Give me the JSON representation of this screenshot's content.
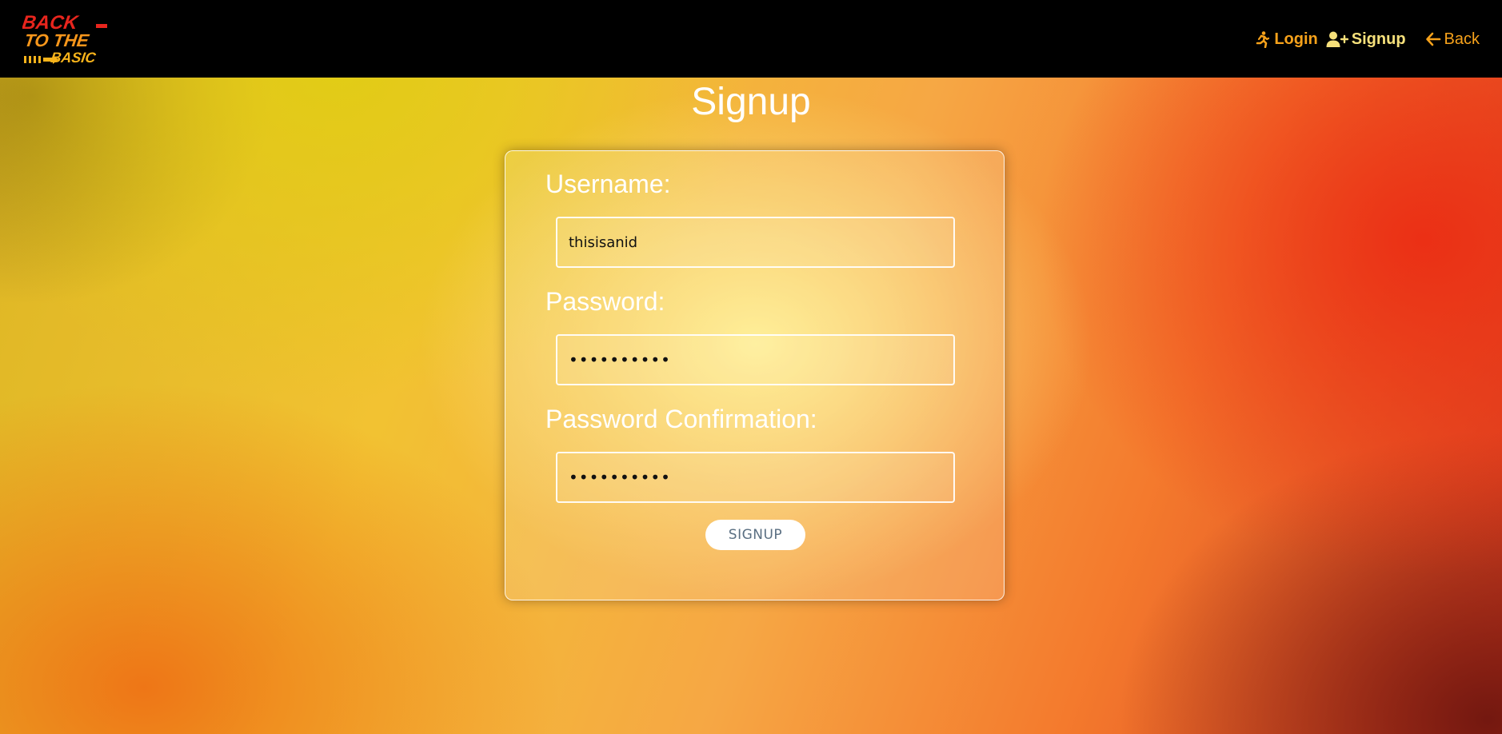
{
  "brand": {
    "logo_line1": "BACK",
    "logo_line2": "TO THE",
    "logo_line3": "BASIC"
  },
  "nav": {
    "login_label": "Login",
    "signup_label": "Signup",
    "back_label": "Back",
    "login_icon": "running-person-icon",
    "signup_icon": "user-plus-icon",
    "back_icon": "arrow-left-icon",
    "colors": {
      "accent": "#f7a21b",
      "active": "#f6e07b",
      "bar": "#000000"
    }
  },
  "page": {
    "title": "Signup"
  },
  "form": {
    "username_label": "Username:",
    "username_value": "thisisanid",
    "password_label": "Password:",
    "password_value": "••••••••••",
    "confirm_label": "Password Confirmation:",
    "confirm_value": "••••••••••",
    "submit_label": "SIGNUP"
  }
}
